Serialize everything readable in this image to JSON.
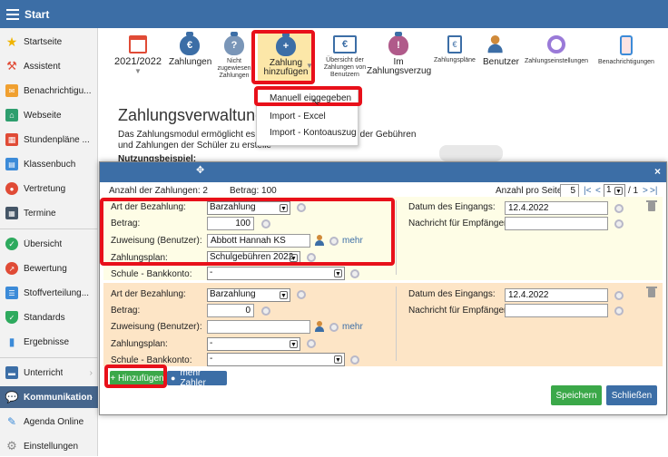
{
  "topbar": {
    "title": "Start"
  },
  "sidebar": {
    "items": [
      {
        "label": "Startseite",
        "icon": "star-icon",
        "color": "#f0b400"
      },
      {
        "label": "Assistent",
        "icon": "wand-icon",
        "color": "#e04b36"
      },
      {
        "label": "Benachrichtigu...",
        "icon": "mail-icon",
        "color": "#f0a030"
      },
      {
        "label": "Webseite",
        "icon": "home-icon",
        "color": "#2e9e6e"
      },
      {
        "label": "Stundenpläne ...",
        "icon": "grid-icon",
        "color": "#e04b36"
      },
      {
        "label": "Klassenbuch",
        "icon": "book-icon",
        "color": "#3c8bd8"
      },
      {
        "label": "Vertretung",
        "icon": "person-icon",
        "color": "#e04b36"
      },
      {
        "label": "Termine",
        "icon": "calendar-icon",
        "color": "#445566"
      },
      {
        "label": "Übersicht",
        "icon": "check-icon",
        "color": "#2eaa5e"
      },
      {
        "label": "Bewertung",
        "icon": "chart-icon",
        "color": "#e04b36"
      },
      {
        "label": "Stoffverteilung...",
        "icon": "list-icon",
        "color": "#3c8bd8"
      },
      {
        "label": "Standards",
        "icon": "shield-icon",
        "color": "#2eaa5e"
      },
      {
        "label": "Ergebnisse",
        "icon": "bar-icon",
        "color": "#3c8bd8"
      },
      {
        "label": "Unterricht",
        "icon": "folder-icon",
        "color": "#3c6ea6"
      },
      {
        "label": "Kommunikation",
        "icon": "chat-icon",
        "color": "#ffffff"
      },
      {
        "label": "Agenda Online",
        "icon": "pen-icon",
        "color": "#3c8bd8"
      },
      {
        "label": "Einstellungen",
        "icon": "gear-icon",
        "color": "#888888"
      }
    ]
  },
  "toolbar": {
    "year": "2021/2022",
    "zahlungen": "Zahlungen",
    "nicht": "Nicht",
    "zugewiesen": "zugewiesen",
    "zahlungen_small": "Zahlungen",
    "hinzu_1": "Zahlung",
    "hinzu_2": "hinzufügen",
    "uebersicht_1": "Übersicht der",
    "uebersicht_2": "Zahlungen von",
    "uebersicht_3": "Benutzern",
    "verzug_1": "Im",
    "verzug_2": "Zahlungsverzug",
    "plaene": "Zahlungspläne",
    "benutzer": "Benutzer",
    "einstellungen": "Zahlungseinstellungen",
    "benachrichtigungen": "Benachrichtigungen",
    "euro": "€"
  },
  "dropdown": {
    "items": [
      "Manuell eingegeben",
      "Import - Excel",
      "Import - Kontoauszug"
    ]
  },
  "page": {
    "title": "Zahlungsverwaltung",
    "text1a": "Das Zahlungsmodul ermöglicht es Sc",
    "text1b": "rsicht der Gebühren",
    "text2": "und Zahlungen der Schüler zu erstelle",
    "text3": "Nutzungsbeispiel:"
  },
  "modal": {
    "count_label": "Anzahl der Zahlungen: 2",
    "amount_label": "Betrag: 100",
    "per_page_label": "Anzahl pro Seite:",
    "per_page": "5",
    "nav_first": "|<",
    "nav_prev": "<",
    "page_select": "1",
    "page_total": "/ 1",
    "nav_next": ">",
    "nav_last": ">|",
    "close": "×",
    "rows": [
      {
        "art_label": "Art der Bezahlung:",
        "art_value": "Barzahlung",
        "betrag_label": "Betrag:",
        "betrag_value": "100",
        "zuweisung_label": "Zuweisung (Benutzer):",
        "zuweisung_value": "Abbott Hannah KS",
        "mehr": "mehr",
        "plan_label": "Zahlungsplan:",
        "plan_value": "Schulgebühren 2022",
        "konto_label": "Schule - Bankkonto:",
        "konto_value": "-",
        "datum_label": "Datum des Eingangs:",
        "datum_value": "12.4.2022",
        "nachricht_label": "Nachricht für Empfänger:",
        "nachricht_value": ""
      },
      {
        "art_label": "Art der Bezahlung:",
        "art_value": "Barzahlung",
        "betrag_label": "Betrag:",
        "betrag_value": "0",
        "zuweisung_label": "Zuweisung (Benutzer):",
        "zuweisung_value": "",
        "mehr": "mehr",
        "plan_label": "Zahlungsplan:",
        "plan_value": "-",
        "konto_label": "Schule - Bankkonto:",
        "konto_value": "-",
        "datum_label": "Datum des Eingangs:",
        "datum_value": "12.4.2022",
        "nachricht_label": "Nachricht für Empfänger:",
        "nachricht_value": ""
      }
    ],
    "add_button": "+ Hinzufügen",
    "more_payers": "mehr Zahler",
    "save": "Speichern",
    "close_button": "Schließen"
  },
  "colors": {
    "accent": "#3c6ea6",
    "highlight": "#e8101a",
    "row1_bg": "#fefde6",
    "row2_bg": "#fde5c6",
    "save_green": "#3ba849"
  }
}
